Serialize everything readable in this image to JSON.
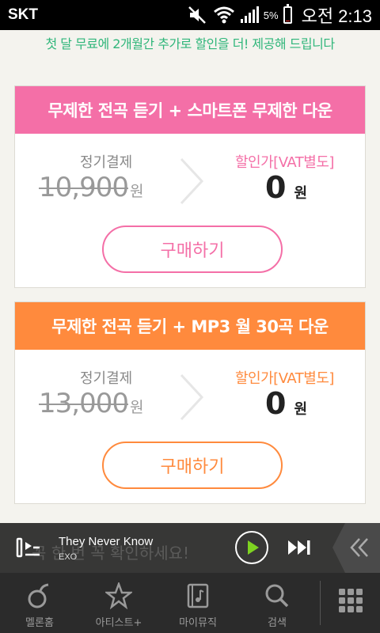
{
  "status_bar": {
    "carrier": "SKT",
    "battery_percent": "5%",
    "battery_level": 0.05,
    "time": "오전 2:13"
  },
  "promo_text": "첫 달 무료에 2개월간 추가로 할인을 더! 제공해 드립니다",
  "plans": [
    {
      "title": "무제한 전곡 듣기 + 스마트폰 무제한 다운",
      "regular_label": "정기결제",
      "original_price": "10,900",
      "original_unit": "원",
      "discount_label": "할인가[VAT별도]",
      "discount_price": "0",
      "discount_unit": "원",
      "buy_label": "구매하기",
      "accent": "#f46fa7"
    },
    {
      "title": "무제한 전곡 듣기 + MP3 월 30곡 다운",
      "regular_label": "정기결제",
      "original_price": "13,000",
      "original_unit": "원",
      "discount_label": "할인가[VAT별도]",
      "discount_price": "0",
      "discount_unit": "원",
      "buy_label": "구매하기",
      "accent": "#ff8a3d"
    }
  ],
  "player": {
    "background_text": "꼭 한 번 꼭 확인하세요!",
    "song_title": "They Never Know",
    "artist": "EXO"
  },
  "nav": {
    "items": [
      {
        "label": "멜론홈",
        "icon": "melon-icon"
      },
      {
        "label": "아티스트+",
        "icon": "star-icon"
      },
      {
        "label": "마이뮤직",
        "icon": "music-note-icon"
      },
      {
        "label": "검색",
        "icon": "search-icon"
      }
    ],
    "more_icon": "grid-menu-icon"
  }
}
